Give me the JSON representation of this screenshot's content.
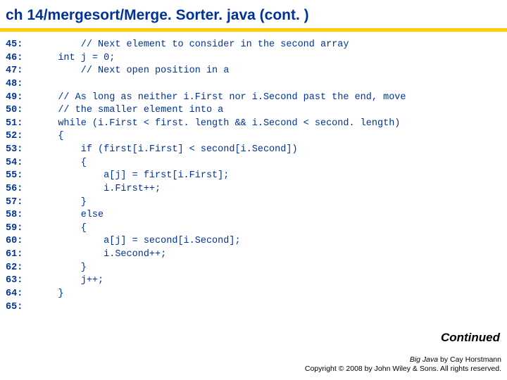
{
  "title": "ch 14/mergesort/Merge. Sorter. java   (cont. )",
  "line_numbers": "45:\n46:\n47:\n48:\n49:\n50:\n51:\n52:\n53:\n54:\n55:\n56:\n57:\n58:\n59:\n60:\n61:\n62:\n63:\n64:\n65:",
  "code": "    // Next element to consider in the second array\nint j = 0;\n    // Next open position in a\n\n// As long as neither i.First nor i.Second past the end, move\n// the smaller element into a\nwhile (i.First < first. length && i.Second < second. length)\n{\n    if (first[i.First] < second[i.Second])\n    {\n        a[j] = first[i.First];\n        i.First++;\n    }\n    else\n    {\n        a[j] = second[i.Second];\n        i.Second++;\n    }\n    j++;\n}\n",
  "continued": "Continued",
  "footer_book": "Big Java",
  "footer_author": " by Cay Horstmann",
  "footer_copy": "Copyright © 2008 by John Wiley & Sons. All rights reserved."
}
